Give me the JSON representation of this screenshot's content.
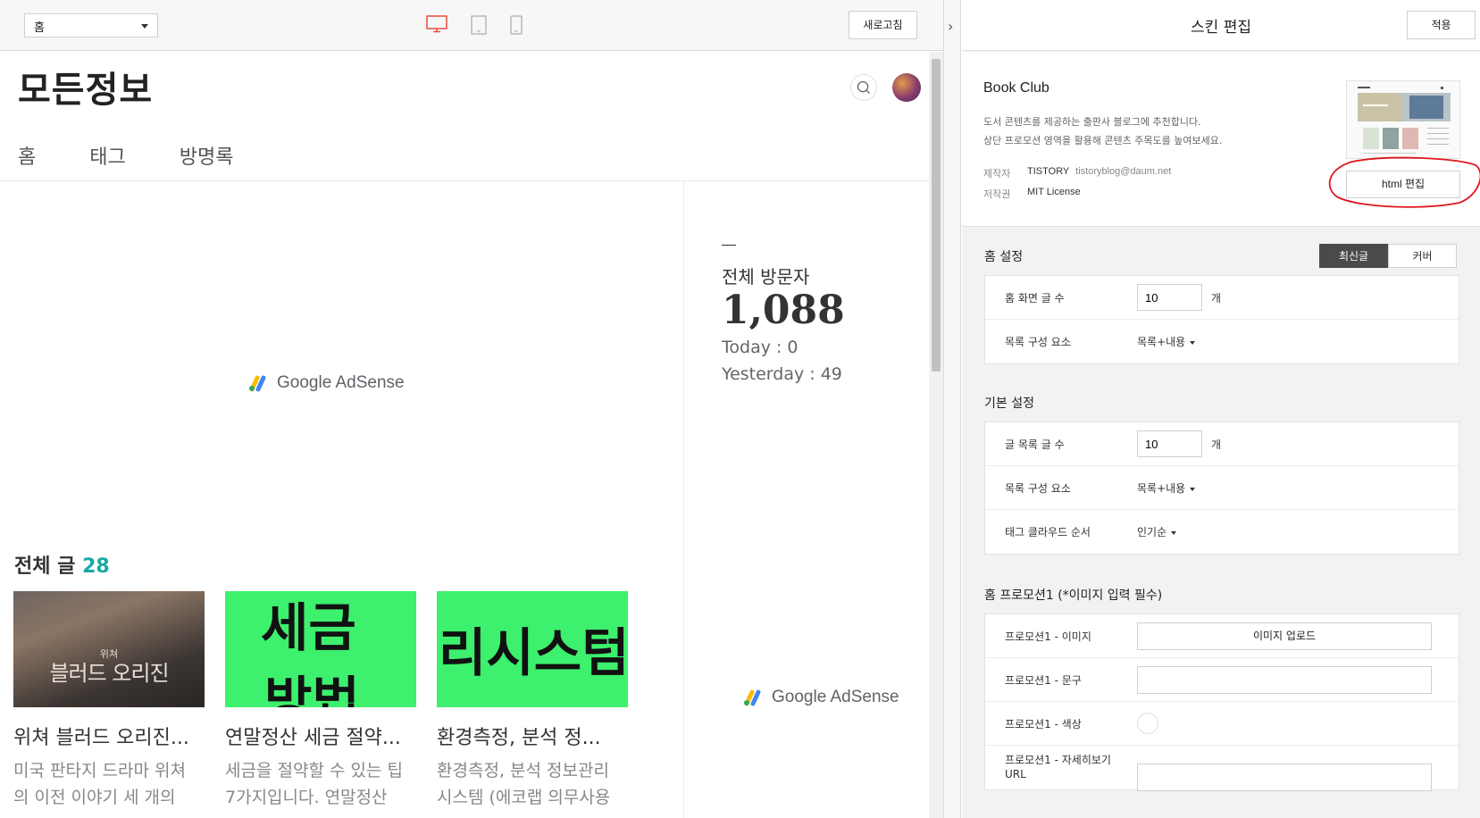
{
  "toolbar": {
    "page_select": "홈",
    "refresh_label": "새로고침",
    "collapse_label": "›"
  },
  "blog": {
    "title": "모든정보",
    "nav": [
      "홈",
      "태그",
      "방명록"
    ],
    "adsense_label": "Google AdSense",
    "visitors": {
      "title": "전체 방문자",
      "total": "1,088",
      "today": "Today : 0",
      "yesterday": "Yesterday : 49"
    },
    "posts_heading": "전체 글",
    "posts_count": "28",
    "posts": [
      {
        "title": "위쳐 블러드 오리진...",
        "excerpt": "미국 판타지 드라마 위쳐 의 이전 이야기 세 개의",
        "thumb_text": "블러드 오리진",
        "thumb_small": "위쳐"
      },
      {
        "title": "연말정산 세금 절약...",
        "excerpt": "세금을 절약할 수 있는 팁 7가지입니다. 연말정산",
        "thumb_text_1": "세금",
        "thumb_text_2": "방법"
      },
      {
        "title": "환경측정, 분석 정...",
        "excerpt": "환경측정, 분석 정보관리 시스템 (에코랩 의무사용",
        "thumb_text_1": "리시스텀"
      }
    ]
  },
  "editor": {
    "title": "스킨 편집",
    "apply_label": "적용",
    "skin": {
      "name": "Book Club",
      "desc_1": "도서 콘텐츠를 제공하는 출판사 블로그에 추천합니다.",
      "desc_2": "상단 프로모션 영역을 활용해 콘텐츠 주목도를 높여보세요.",
      "author_label": "제작자",
      "author": "TISTORY",
      "author_email": "tistoryblog@daum.net",
      "license_label": "저작권",
      "license": "MIT License",
      "html_edit_label": "html 편집"
    },
    "home_settings": {
      "title": "홈 설정",
      "toggle": [
        "최신글",
        "커버"
      ],
      "active_toggle": "최신글",
      "rows": [
        {
          "label": "홈 화면 글 수",
          "value": "10",
          "unit": "개"
        },
        {
          "label": "목록 구성 요소",
          "dropdown": "목록+내용"
        }
      ]
    },
    "basic_settings": {
      "title": "기본 설정",
      "rows": [
        {
          "label": "글 목록 글 수",
          "value": "10",
          "unit": "개"
        },
        {
          "label": "목록 구성 요소",
          "dropdown": "목록+내용"
        },
        {
          "label": "태그 클라우드 순서",
          "dropdown": "인기순"
        }
      ]
    },
    "promo_settings": {
      "title": "홈 프로모션1 (*이미지 입력 필수)",
      "rows": [
        {
          "label": "프로모션1 - 이미지",
          "button": "이미지 업로드"
        },
        {
          "label": "프로모션1 - 문구",
          "value": ""
        },
        {
          "label": "프로모션1 - 색상",
          "color": "#ffffff"
        },
        {
          "label": "프로모션1 - 자세히보기 URL",
          "value": ""
        }
      ]
    }
  },
  "colors": {
    "accent_teal": "#18a9a2",
    "active_device": "#e74c3c",
    "toggle_active": "#4a4a4a",
    "annotation_red": "#e0161e"
  }
}
